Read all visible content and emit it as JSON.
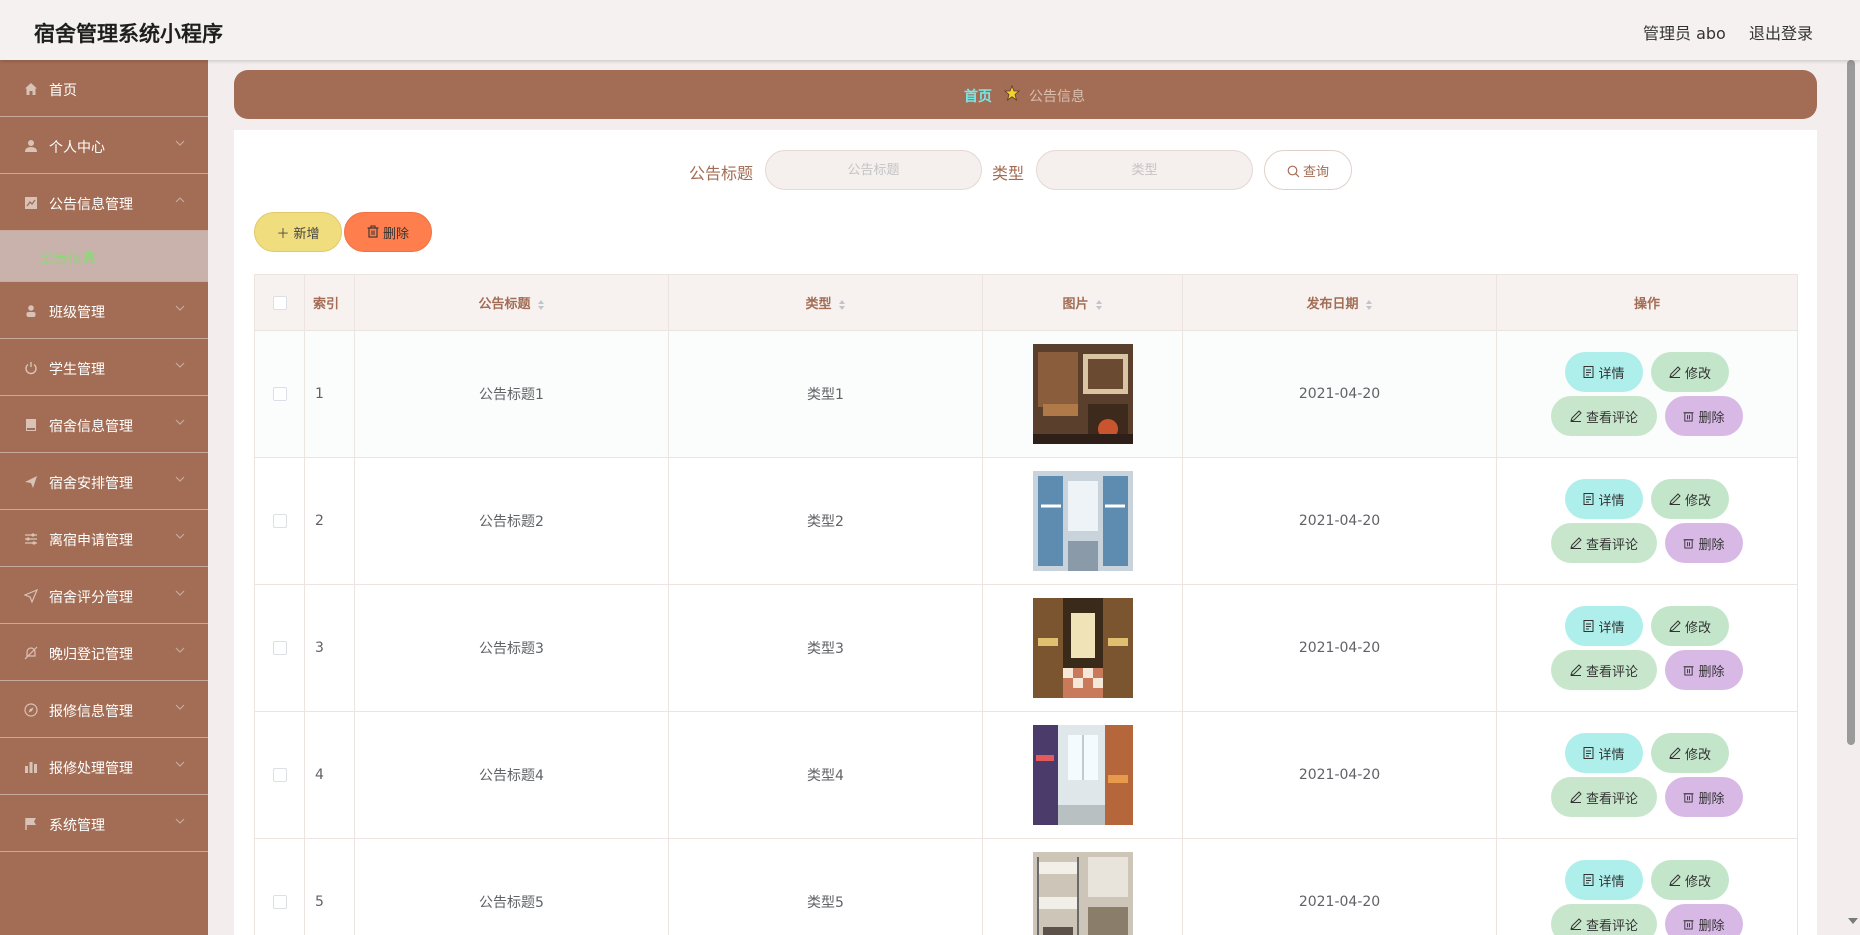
{
  "header": {
    "app_title": "宿舍管理系统小程序",
    "admin_label": "管理员 abo",
    "logout_label": "退出登录"
  },
  "sidebar": {
    "items": [
      {
        "label": "首页",
        "icon": "home-icon"
      },
      {
        "label": "个人中心",
        "icon": "user-icon"
      },
      {
        "label": "公告信息管理",
        "icon": "notice-icon"
      },
      {
        "label": "班级管理",
        "icon": "person-icon"
      },
      {
        "label": "学生管理",
        "icon": "power-icon"
      },
      {
        "label": "宿舍信息管理",
        "icon": "book-icon"
      },
      {
        "label": "宿舍安排管理",
        "icon": "send-icon"
      },
      {
        "label": "离宿申请管理",
        "icon": "sliders-icon"
      },
      {
        "label": "宿舍评分管理",
        "icon": "navigation-icon"
      },
      {
        "label": "晚归登记管理",
        "icon": "bell-off-icon"
      },
      {
        "label": "报修信息管理",
        "icon": "compass-icon"
      },
      {
        "label": "报修处理管理",
        "icon": "chart-icon"
      },
      {
        "label": "系统管理",
        "icon": "flag-icon"
      }
    ],
    "active_sub": "公告信息"
  },
  "breadcrumb": {
    "home": "首页",
    "current": "公告信息"
  },
  "search": {
    "title_label": "公告标题",
    "title_placeholder": "公告标题",
    "type_label": "类型",
    "type_placeholder": "类型",
    "query_button": "查询"
  },
  "toolbar": {
    "add_label": "新增",
    "delete_label": "删除"
  },
  "table": {
    "columns": [
      "索引",
      "公告标题",
      "类型",
      "图片",
      "发布日期",
      "操作"
    ],
    "rows": [
      {
        "index": "1",
        "title": "公告标题1",
        "type": "类型1",
        "date": "2021-04-20"
      },
      {
        "index": "2",
        "title": "公告标题2",
        "type": "类型2",
        "date": "2021-04-20"
      },
      {
        "index": "3",
        "title": "公告标题3",
        "type": "类型3",
        "date": "2021-04-20"
      },
      {
        "index": "4",
        "title": "公告标题4",
        "type": "类型4",
        "date": "2021-04-20"
      },
      {
        "index": "5",
        "title": "公告标题5",
        "type": "类型5",
        "date": "2021-04-20"
      }
    ],
    "actions": {
      "detail": "详情",
      "edit": "修改",
      "comments": "查看评论",
      "delete": "删除"
    }
  },
  "colors": {
    "brand": "#a36d55",
    "header_bg": "#f5f1f0",
    "active_sub_text": "#8fd67a",
    "breadcrumb_home": "#78e7e7",
    "add_button": "#f0dd7e",
    "delete_button": "#fe7f4d",
    "detail_button": "#aeeeeb",
    "edit_button": "#c3e6cb",
    "row_delete_button": "#d8b9e6"
  }
}
